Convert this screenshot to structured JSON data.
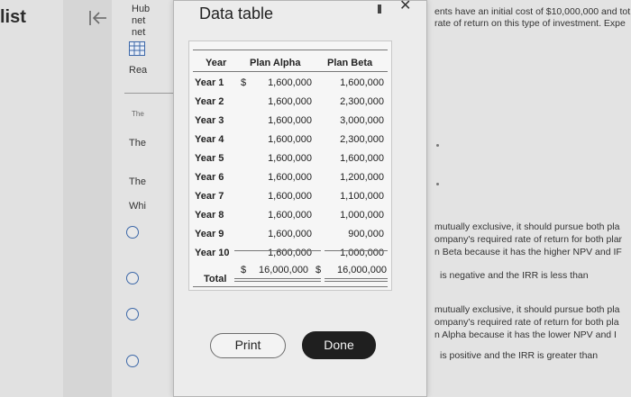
{
  "background": {
    "page_title": "list",
    "left_column": {
      "top_lines": [
        "Hub",
        "net",
        "net"
      ],
      "rea": "Rea",
      "the_1": "The",
      "the_2": "The",
      "the_3": "The",
      "whi": "Whi"
    },
    "right_panel": {
      "intro_lines": [
        "ents have an initial cost of $10,000,000 and tot",
        "rate of return on this type of investment. Expe"
      ],
      "option_a": [
        "mutually exclusive, it should pursue both pla",
        "ompany's required rate of return for both plar",
        "n Beta because it has the higher NPV and IF"
      ],
      "option_b": "is negative and the IRR is less than",
      "option_c": [
        "mutually exclusive, it should pursue both pla",
        "ompany's required rate of return for both pla",
        "n Alpha because it has the lower NPV and I"
      ],
      "option_d": "is positive and the IRR is greater than"
    }
  },
  "dialog": {
    "title": "Data table",
    "close_symbol": "✕",
    "print_label": "Print",
    "done_label": "Done",
    "table": {
      "headers": [
        "Year",
        "Plan Alpha",
        "Plan Beta"
      ],
      "currency": "$",
      "rows": [
        {
          "year": "Year 1",
          "alpha": "1,600,000",
          "beta": "1,600,000"
        },
        {
          "year": "Year 2",
          "alpha": "1,600,000",
          "beta": "2,300,000"
        },
        {
          "year": "Year 3",
          "alpha": "1,600,000",
          "beta": "3,000,000"
        },
        {
          "year": "Year 4",
          "alpha": "1,600,000",
          "beta": "2,300,000"
        },
        {
          "year": "Year 5",
          "alpha": "1,600,000",
          "beta": "1,600,000"
        },
        {
          "year": "Year 6",
          "alpha": "1,600,000",
          "beta": "1,200,000"
        },
        {
          "year": "Year 7",
          "alpha": "1,600,000",
          "beta": "1,100,000"
        },
        {
          "year": "Year 8",
          "alpha": "1,600,000",
          "beta": "1,000,000"
        },
        {
          "year": "Year 9",
          "alpha": "1,600,000",
          "beta": "900,000"
        },
        {
          "year": "Year 10",
          "alpha": "1,600,000",
          "beta": "1,000,000"
        }
      ],
      "total": {
        "label": "Total",
        "alpha": "16,000,000",
        "beta": "16,000,000"
      }
    }
  }
}
